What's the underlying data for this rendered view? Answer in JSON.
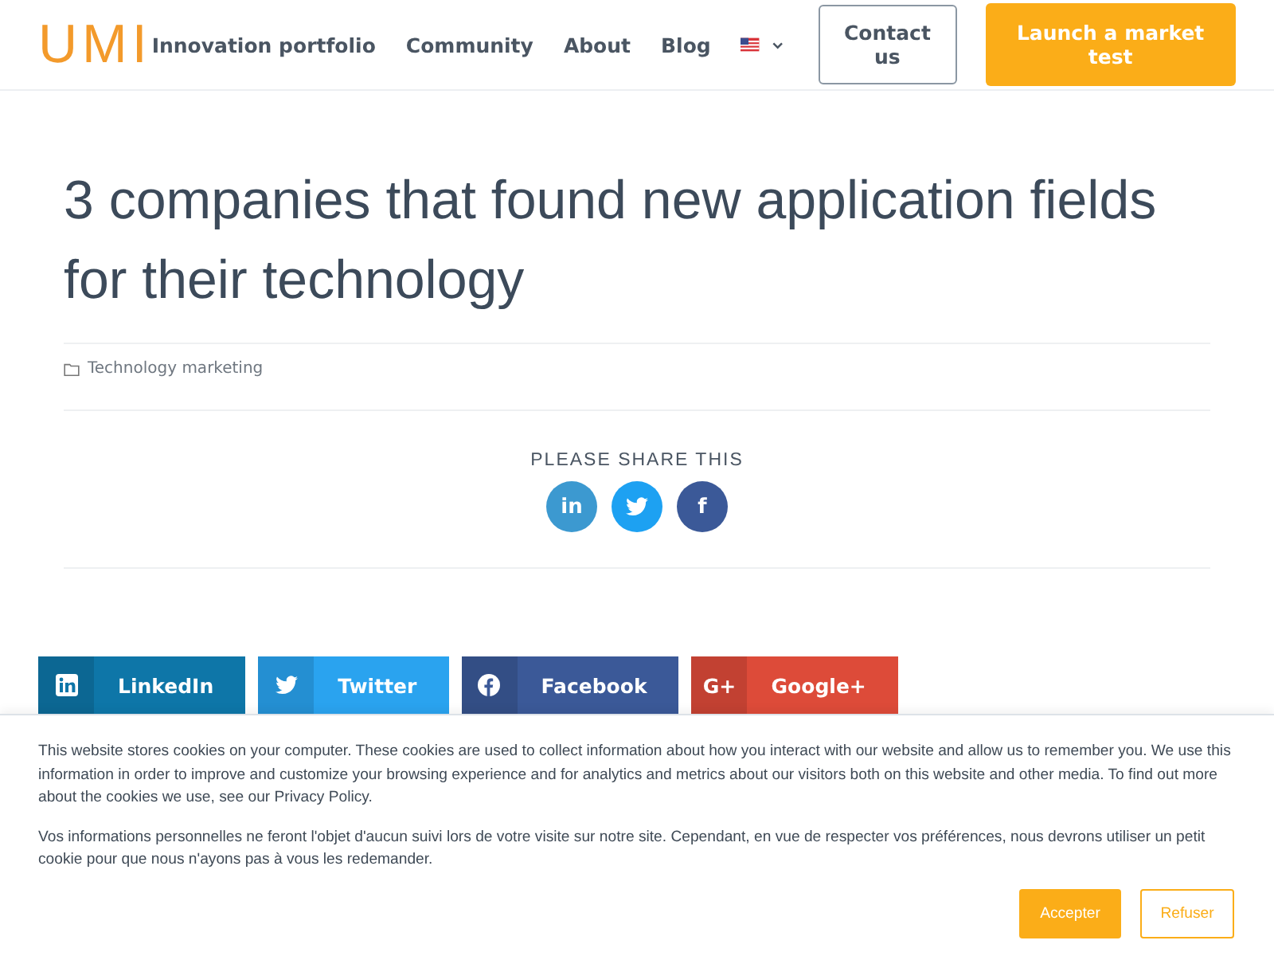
{
  "header": {
    "logo": "UMI",
    "nav": [
      {
        "label": "Innovation portfolio"
      },
      {
        "label": "Community"
      },
      {
        "label": "About"
      },
      {
        "label": "Blog"
      }
    ],
    "contact_button": "Contact us",
    "cta_button": "Launch a market test"
  },
  "article": {
    "title": "3 companies that found new application fields for their technology",
    "category": "Technology marketing"
  },
  "share": {
    "heading": "PLEASE SHARE THIS",
    "round_buttons": [
      {
        "kind": "linkedin",
        "label": "in",
        "color": "#3c99d0"
      },
      {
        "kind": "twitter",
        "color": "#1da1f2"
      },
      {
        "kind": "facebook",
        "label": "f",
        "color": "#3b5998"
      }
    ],
    "buttons": [
      {
        "kind": "linkedin",
        "label": "LinkedIn",
        "color": "#0e76a8"
      },
      {
        "kind": "twitter",
        "label": "Twitter",
        "color": "#2aa3ef"
      },
      {
        "kind": "facebook",
        "label": "Facebook",
        "color": "#3b5998"
      },
      {
        "kind": "google",
        "label": "Google+",
        "icon_text": "G+",
        "color": "#dd4b39"
      }
    ]
  },
  "cookie_banner": {
    "paragraphs": [
      "This website stores cookies on your computer. These cookies are used to collect information about how you interact with our website and allow us to remember you. We use this information in order to improve and customize your browsing experience and for analytics and metrics about our visitors both on this website and other media. To find out more about the cookies we use, see our Privacy Policy.",
      "Vos informations personnelles ne feront l'objet d'aucun suivi lors de votre visite sur notre site. Cependant, en vue de respecter vos préférences, nous devrons utiliser un petit cookie pour que nous n'ayons pas à vous les redemander."
    ],
    "accept_button": "Accepter",
    "decline_button": "Refuser"
  }
}
